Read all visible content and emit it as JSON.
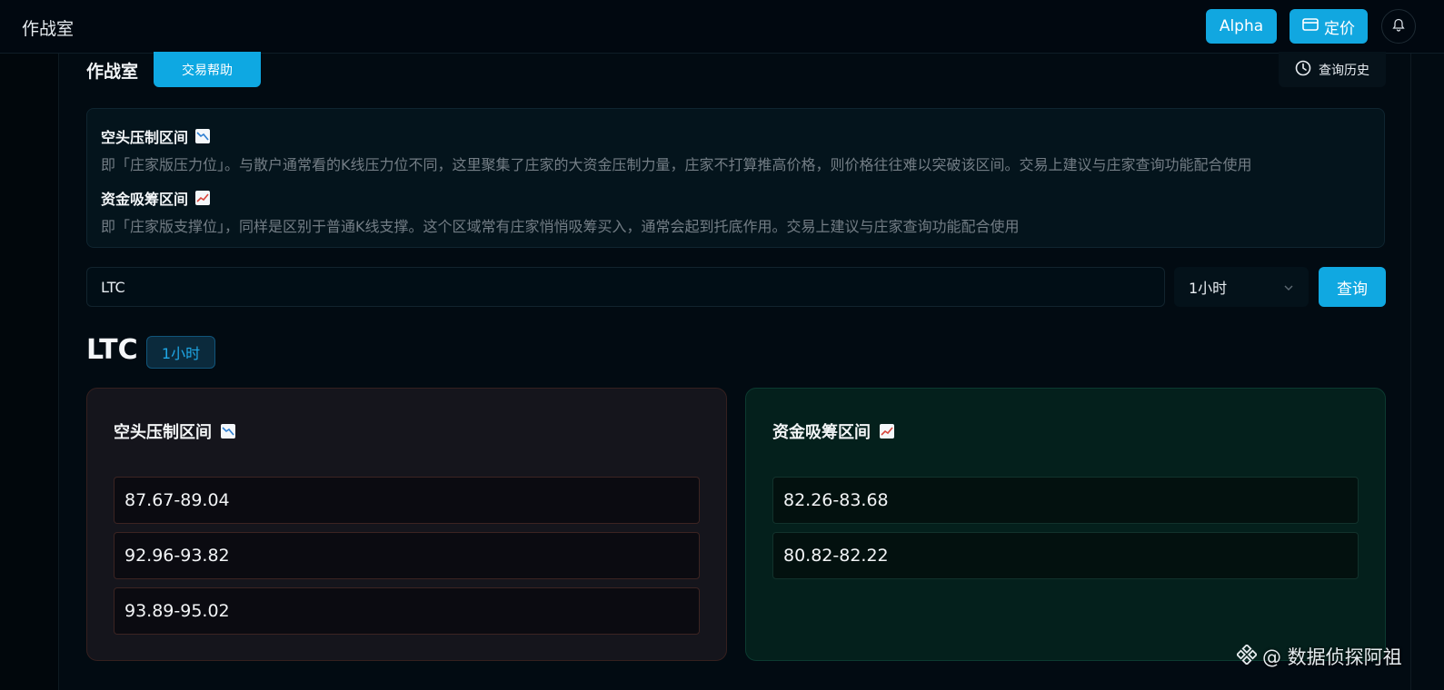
{
  "header": {
    "app_title": "作战室",
    "alpha_label": "Alpha",
    "pricing_label": "定价",
    "icons": {
      "pricing": "card-icon",
      "bell": "bell-icon"
    }
  },
  "panel": {
    "title": "作战室",
    "help_label": "交易帮助",
    "history_label": "查询历史",
    "history_icon": "clock-icon"
  },
  "info": {
    "resistance": {
      "title": "空头压制区间",
      "icon": "chart-decreasing-emoji",
      "desc": "即「庄家版压力位」。与散户通常看的K线压力位不同，这里聚集了庄家的大资金压制力量，庄家不打算推高价格，则价格往往难以突破该区间。交易上建议与庄家查询功能配合使用"
    },
    "support": {
      "title": "资金吸筹区间",
      "icon": "chart-increasing-emoji",
      "desc": "即「庄家版支撑位」，同样是区别于普通K线支撑。这个区域常有庄家悄悄吸筹买入，通常会起到托底作用。交易上建议与庄家查询功能配合使用"
    }
  },
  "search": {
    "value": "LTC",
    "interval": "1小时",
    "query_label": "查询"
  },
  "result": {
    "symbol": "LTC",
    "interval_badge": "1小时",
    "resistance_title": "空头压制区间",
    "support_title": "资金吸筹区间",
    "resistance_zones": [
      "87.67-89.04",
      "92.96-93.82",
      "93.89-95.02"
    ],
    "support_zones": [
      "82.26-83.68",
      "80.82-82.22"
    ]
  },
  "watermark": {
    "text": "@ 数据侦探阿祖",
    "icon": "binance-icon"
  },
  "colors": {
    "accent": "#11a7e0",
    "resistance_red": "#e0483f",
    "support_green": "#1fb86a"
  }
}
